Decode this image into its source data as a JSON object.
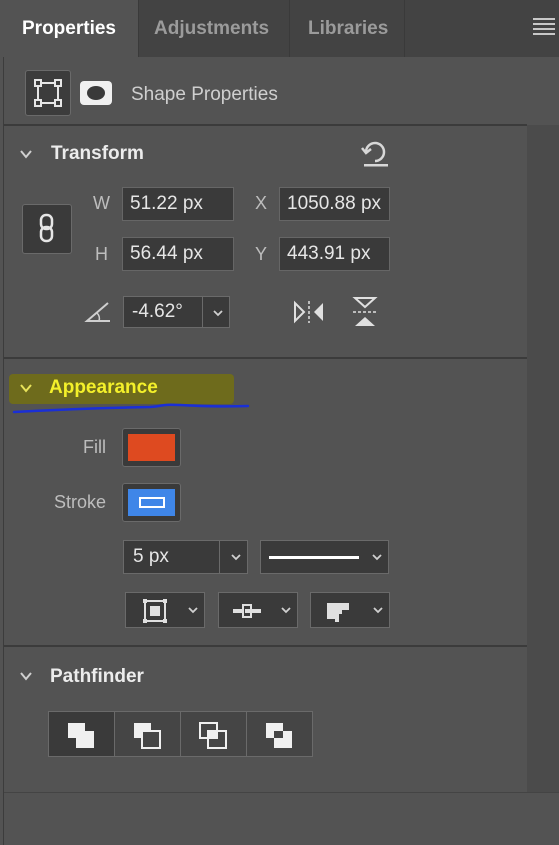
{
  "tabs": [
    {
      "label": "Properties",
      "active": true
    },
    {
      "label": "Adjustments",
      "active": false
    },
    {
      "label": "Libraries",
      "active": false
    }
  ],
  "header": {
    "subtitle": "Shape Properties"
  },
  "transform": {
    "title": "Transform",
    "w_label": "W",
    "w_value": "51.22 px",
    "x_label": "X",
    "x_value": "1050.88 px",
    "h_label": "H",
    "h_value": "56.44 px",
    "y_label": "Y",
    "y_value": "443.91 px",
    "angle_value": "-4.62°"
  },
  "appearance": {
    "title": "Appearance",
    "fill_label": "Fill",
    "fill_color": "#de4a20",
    "stroke_label": "Stroke",
    "stroke_color": "#3f86e8",
    "stroke_width": "5 px"
  },
  "pathfinder": {
    "title": "Pathfinder"
  },
  "colors": {
    "highlight": "#6e6b1c",
    "annotation_underline": "#1a2fd6",
    "appearance_title": "#f4f02a"
  }
}
